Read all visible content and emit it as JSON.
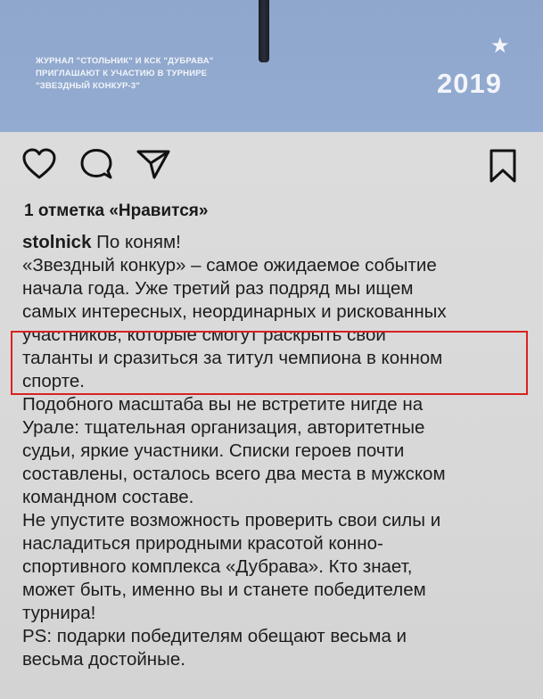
{
  "banner": {
    "invite_lines": [
      "ЖУРНАЛ \"СТОЛЬНИК\" И КСК \"ДУБРАВА\"",
      "ПРИГЛАШАЮТ К УЧАСТИЮ В ТУРНИРЕ",
      "\"ЗВЕЗДНЫЙ КОНКУР-3\""
    ],
    "star_glyph": "★",
    "year": "2019"
  },
  "actions": {
    "icons": [
      "heart-icon",
      "comment-icon",
      "share-icon",
      "bookmark-icon"
    ]
  },
  "likes": "1 отметка «Нравится»",
  "caption": {
    "username": "stolnick",
    "first_line_text": " По коням!",
    "lines": [
      "«Звездный конкур» – самое ожидаемое событие",
      "начала года. Уже третий раз подряд мы ищем",
      "самых интересных, неординарных и рискованных",
      "участников, которые смогут раскрыть свои",
      "таланты и сразиться за титул чемпиона в конном",
      "спорте.",
      "Подобного масштаба вы не встретите нигде на",
      "Урале: тщательная организация, авторитетные",
      "судьи, яркие участники. Списки героев почти",
      "составлены, осталось всего два места в мужском",
      "командном составе.",
      "Не упустите возможность проверить свои силы и",
      "насладиться природными красотой конно-",
      "спортивного комплекса «Дубрава». Кто знает,",
      "может быть, именно вы и станете победителем",
      "турнира!",
      "PS: подарки победителям обещают весьма и",
      "весьма достойные."
    ]
  },
  "colors": {
    "banner": "#8fa7cc",
    "highlight": "#d9231f",
    "text": "#1d1d1d"
  }
}
